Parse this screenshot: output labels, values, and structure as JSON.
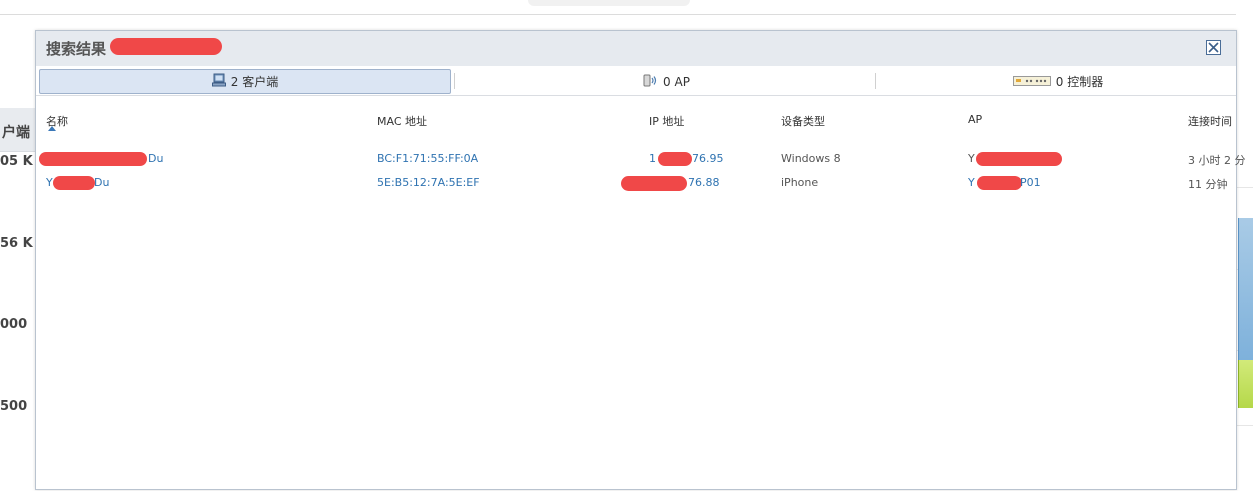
{
  "background": {
    "left_header": "户端",
    "left_values": [
      "05 K",
      "56 K",
      "000",
      "500"
    ]
  },
  "dialog": {
    "title": "搜索结果",
    "close_icon": "close-icon",
    "tabs": [
      {
        "icon": "monitor-icon",
        "label": "2 客户端",
        "active": true
      },
      {
        "icon": "access-point-icon",
        "label": "0 AP",
        "active": false
      },
      {
        "icon": "controller-icon",
        "label": "0 控制器",
        "active": false
      }
    ],
    "table": {
      "columns": [
        "名称",
        "MAC 地址",
        "IP 地址",
        "设备类型",
        "AP",
        "连接时间"
      ],
      "sort_column": "名称",
      "sort_direction": "ascending",
      "rows": [
        {
          "name": "Du",
          "mac": "BC:F1:71:55:FF:0A",
          "ip_prefix": "1",
          "ip_suffix": "76.95",
          "device": "Windows 8",
          "ap": "Y",
          "time": "3 小时 2 分"
        },
        {
          "name_prefix": "Y",
          "name": "Du",
          "mac": "5E:B5:12:7A:5E:EF",
          "ip_suffix": "76.88",
          "device": "iPhone",
          "ap_prefix": "Y",
          "ap": "P01",
          "time": "11 分钟"
        }
      ]
    }
  },
  "colors": {
    "link": "#2f73b1",
    "redaction": "#f04848",
    "active_tab": "#dbe5f3"
  }
}
